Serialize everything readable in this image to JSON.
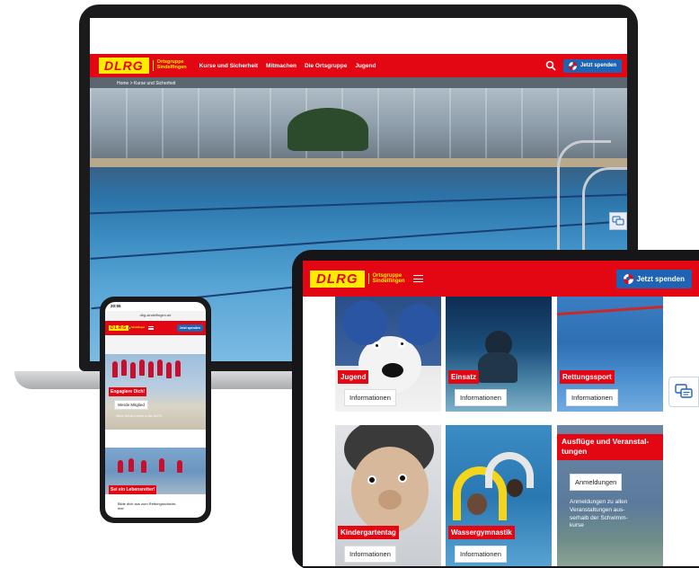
{
  "laptop": {
    "logo": {
      "word": "DLRG",
      "sub_line1": "Ortsgruppe",
      "sub_line2": "Sindelfingen"
    },
    "nav": [
      "Kurse und Sicherheit",
      "Mitmachen",
      "Die Ortsgruppe",
      "Jugend"
    ],
    "donate_label": "Jetzt spenden",
    "breadcrumb": "Home > Kurse und Sicherheit"
  },
  "tablet": {
    "logo": {
      "word": "DLRG",
      "sub_line1": "Ortsgruppe",
      "sub_line2": "Sindelfingen"
    },
    "donate_label": "Jetzt spenden",
    "cards": [
      {
        "tag": "Jugend",
        "button": "Informationen"
      },
      {
        "tag": "Einsatz",
        "button": "Informationen"
      },
      {
        "tag": "Rettungssport",
        "button": "Informationen"
      },
      {
        "tag": "Kindergartentag",
        "button": "Informationen"
      },
      {
        "tag": "Wassergymnastik",
        "button": "Informationen"
      }
    ],
    "event_card": {
      "title_line1": "Ausflüge und Veranstal-",
      "title_line2": "tungen",
      "button": "Anmeldungen",
      "desc_line1": "Anmeldungen zu allen",
      "desc_line2": "Veranstaltungen aus-",
      "desc_line3": "serhalb der Schwimm-",
      "desc_line4": "kurse"
    }
  },
  "phone": {
    "time": "20:55",
    "url": "dlrg-sindelfingen.de",
    "logo": {
      "word": "DLRG",
      "sub": "Sindelfingen"
    },
    "donate_label": "Jetzt spenden",
    "card1": {
      "tag": "Engagiere Dich!",
      "button": "Werde Mitglied",
      "note": "Nimm teil am Leben in der DLRG"
    },
    "card2": {
      "tag": "Sei ein Lebensretter!",
      "caption_line1": "Bilde dich aus zum Rettungsschwim-",
      "caption_line2": "mer"
    }
  },
  "colors": {
    "brand_red": "#e30613",
    "brand_yellow": "#ffed00",
    "donate_blue": "#1e63b4"
  }
}
